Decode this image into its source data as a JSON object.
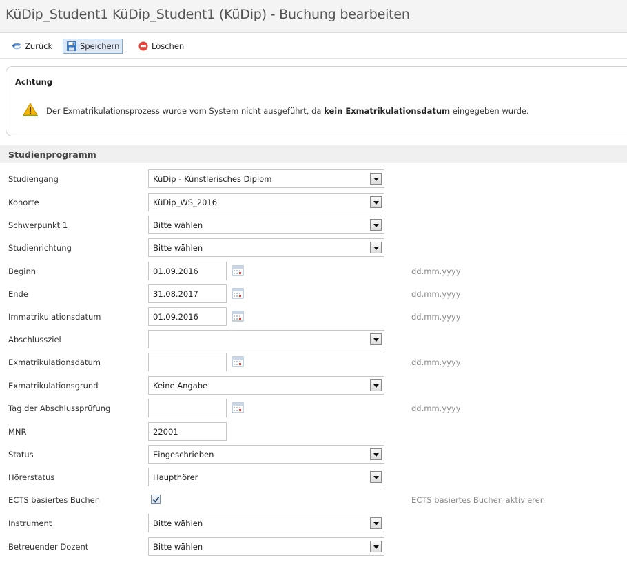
{
  "window": {
    "title": "KüDip_Student1 KüDip_Student1 (KüDip) - Buchung bearbeiten"
  },
  "toolbar": {
    "back_label": "Zurück",
    "save_label": "Speichern",
    "delete_label": "Löschen"
  },
  "alert": {
    "title": "Achtung",
    "message_pre": "Der Exmatrikulationsprozess wurde vom System nicht ausgeführt, da ",
    "message_bold": "kein Exmatrikulationsdatum",
    "message_post": " eingegeben wurde."
  },
  "section": {
    "title": "Studienprogramm"
  },
  "date_hint": "dd.mm.yyyy",
  "fields": {
    "studiengang": {
      "label": "Studiengang",
      "value": "KüDip - Künstlerisches Diplom"
    },
    "kohorte": {
      "label": "Kohorte",
      "value": "KüDip_WS_2016"
    },
    "schwerpunkt": {
      "label": "Schwerpunkt 1",
      "value": "Bitte wählen"
    },
    "studienrichtung": {
      "label": "Studienrichtung",
      "value": "Bitte wählen"
    },
    "beginn": {
      "label": "Beginn",
      "value": "01.09.2016"
    },
    "ende": {
      "label": "Ende",
      "value": "31.08.2017"
    },
    "immatrikulationsdatum": {
      "label": "Immatrikulationsdatum",
      "value": "01.09.2016"
    },
    "abschlussziel": {
      "label": "Abschlussziel",
      "value": ""
    },
    "exmatrikulationsdatum": {
      "label": "Exmatrikulationsdatum",
      "value": ""
    },
    "exmatrikulationsgrund": {
      "label": "Exmatrikulationsgrund",
      "value": "Keine Angabe"
    },
    "abschlusspruefung": {
      "label": "Tag der Abschlussprüfung",
      "value": ""
    },
    "mnr": {
      "label": "MNR",
      "value": "22001"
    },
    "status": {
      "label": "Status",
      "value": "Eingeschrieben"
    },
    "hoererstatus": {
      "label": "Hörerstatus",
      "value": "Haupthörer"
    },
    "ects": {
      "label": "ECTS basiertes Buchen",
      "checked": true,
      "hint": "ECTS basiertes Buchen aktivieren"
    },
    "instrument": {
      "label": "Instrument",
      "value": "Bitte wählen"
    },
    "dozent": {
      "label": "Betreuender Dozent",
      "value": "Bitte wählen"
    }
  },
  "colors": {
    "accent": "#7ea7d8",
    "warning": "#f2b705",
    "delete": "#e0443a"
  }
}
